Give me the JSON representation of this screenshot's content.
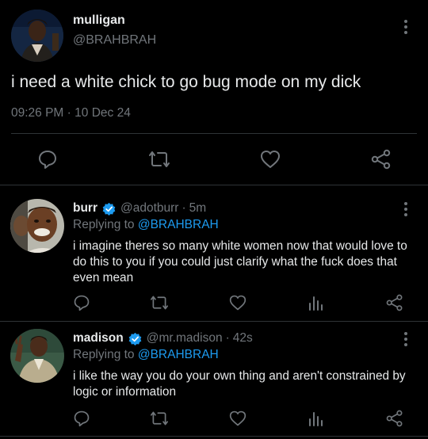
{
  "main_tweet": {
    "display_name": "mulligan",
    "handle": "@BRAHBRAH",
    "text": "i need a white chick to go bug mode on my dick",
    "time": "09:26 PM",
    "separator": "·",
    "date": "10 Dec 24",
    "actions": [
      "reply-icon",
      "retweet-icon",
      "like-icon",
      "share-icon"
    ]
  },
  "replies": [
    {
      "display_name": "burr",
      "verified": true,
      "handle": "@adotburr",
      "separator": "·",
      "age": "5m",
      "replying_prefix": "Replying to",
      "replying_to": "@BRAHBRAH",
      "text_line1": "i imagine theres so many white women now that would love to",
      "text_line2": "do this to you if you could just clarify what the fuck does that",
      "text_line3": "even mean",
      "actions": [
        "reply-icon",
        "retweet-icon",
        "like-icon",
        "analytics-icon",
        "share-icon"
      ]
    },
    {
      "display_name": "madison",
      "verified": true,
      "handle": "@mr.madison",
      "separator": "·",
      "age": "42s",
      "replying_prefix": "Replying to",
      "replying_to": "@BRAHBRAH",
      "text_line1": "i like the way you do your own thing and aren't constrained by",
      "text_line2": "logic or information",
      "actions": [
        "reply-icon",
        "retweet-icon",
        "like-icon",
        "analytics-icon",
        "share-icon"
      ]
    }
  ],
  "colors": {
    "background": "#000000",
    "text": "#e7e9ea",
    "muted": "#71767b",
    "accent": "#1d9bf0",
    "divider": "#2f3336"
  }
}
